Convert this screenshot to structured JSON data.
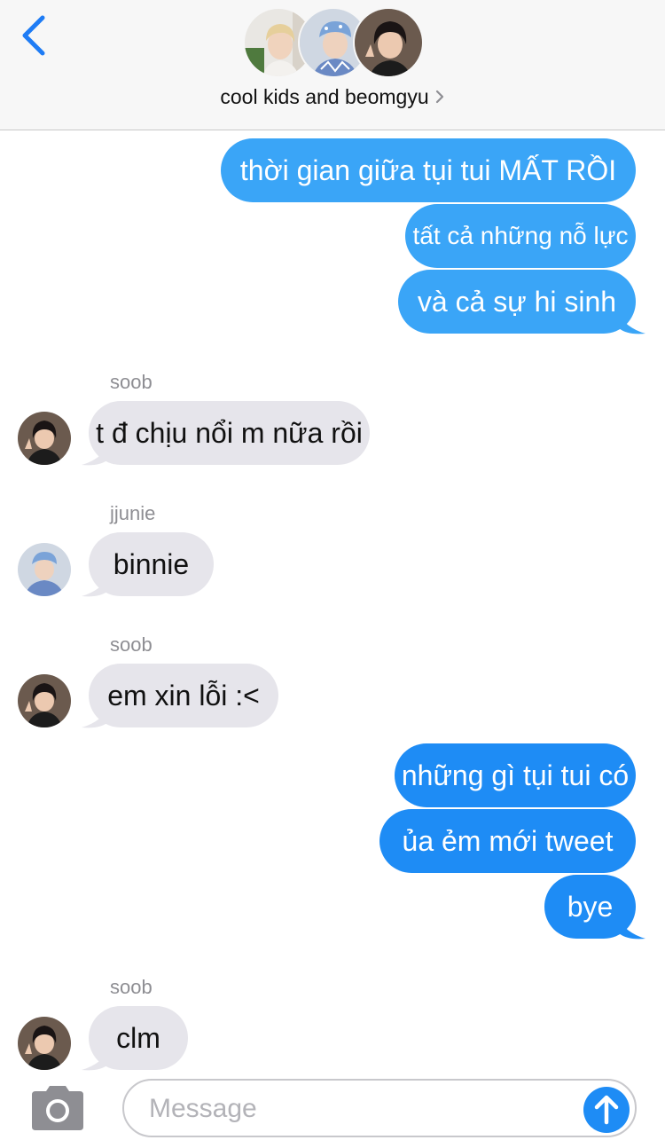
{
  "header": {
    "group_name": "cool kids and beomgyu"
  },
  "messages": {
    "out1": "thời gian giữa tụi tui MẤT RỒI",
    "out2": "tất cả những nỗ lực",
    "out3": "và cả sự hi sinh",
    "in1_sender": "soob",
    "in1_text": "t đ chịu nổi m nữa rồi",
    "in2_sender": "jjunie",
    "in2_text": "binnie",
    "in3_sender": "soob",
    "in3_text": "em xin lỗi :<",
    "out4": "những gì tụi tui có",
    "out5": "ủa ẻm mới tweet",
    "out6": "bye",
    "in4_sender": "soob",
    "in4_text": "clm"
  },
  "composer": {
    "placeholder": "Message"
  },
  "colors": {
    "outgoing_bubble": "#1e8cf5",
    "outgoing_bubble_light": "#3aa5f7",
    "incoming_bubble": "#e6e5eb",
    "accent": "#1e8cf5"
  },
  "icons": {
    "back": "chevron-left-icon",
    "title_chevron": "chevron-right-icon",
    "camera": "camera-icon",
    "send": "arrow-up-icon"
  }
}
